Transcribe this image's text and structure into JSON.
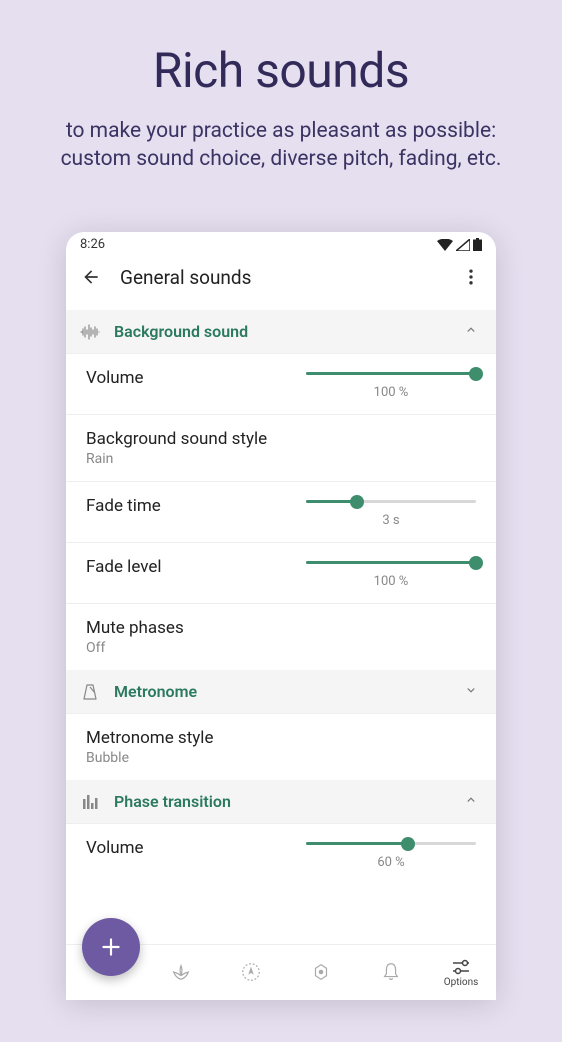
{
  "promo": {
    "title": "Rich sounds",
    "subtitle_line1": "to make your practice as pleasant as possible:",
    "subtitle_line2": "custom sound choice, diverse pitch, fading, etc."
  },
  "status": {
    "time": "8:26"
  },
  "appbar": {
    "title": "General sounds"
  },
  "sections": {
    "background": {
      "title": "Background sound"
    },
    "metronome": {
      "title": "Metronome"
    },
    "phase": {
      "title": "Phase transition"
    }
  },
  "settings": {
    "volume": {
      "label": "Volume",
      "value_text": "100 %",
      "fill": 100
    },
    "bg_style": {
      "label": "Background sound style",
      "value": "Rain"
    },
    "fade_time": {
      "label": "Fade time",
      "value_text": "3 s",
      "fill": 30
    },
    "fade_level": {
      "label": "Fade level",
      "value_text": "100 %",
      "fill": 100
    },
    "mute_phases": {
      "label": "Mute phases",
      "value": "Off"
    },
    "metronome_style": {
      "label": "Metronome style",
      "value": "Bubble"
    },
    "phase_volume": {
      "label": "Volume",
      "value_text": "60 %",
      "fill": 60
    }
  },
  "nav": {
    "options": "Options"
  }
}
